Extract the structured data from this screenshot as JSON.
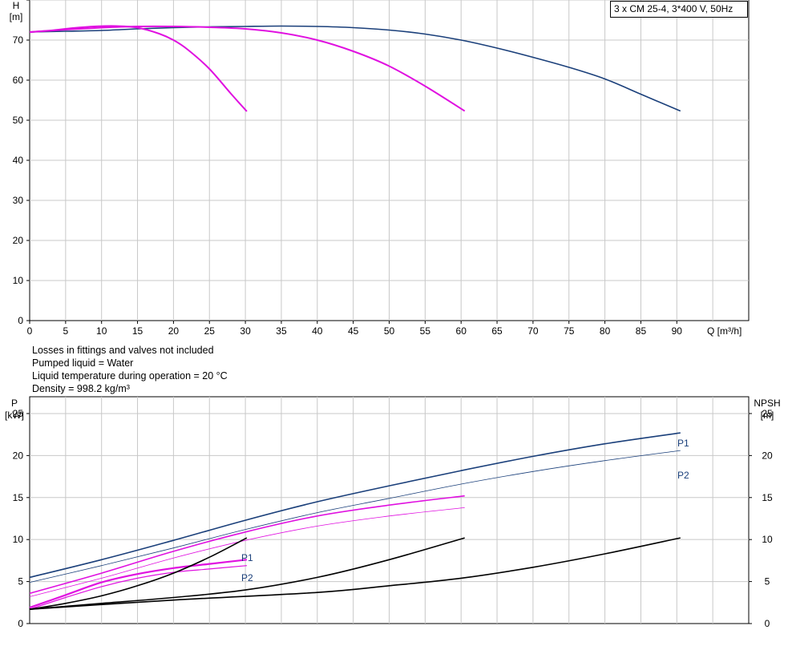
{
  "chart_data": [
    {
      "type": "line",
      "title": "3 x CM 25-4, 3*400 V, 50Hz",
      "ylabel": "H",
      "yunit": "[m]",
      "xlabel": "Q [m³/h]",
      "xlim": [
        0,
        100
      ],
      "ylim": [
        0,
        80
      ],
      "xticks": [
        "0",
        "5",
        "10",
        "15",
        "20",
        "25",
        "30",
        "35",
        "40",
        "45",
        "50",
        "55",
        "60",
        "65",
        "70",
        "75",
        "80",
        "85",
        "90"
      ],
      "yticks": [
        "0",
        "10",
        "20",
        "30",
        "40",
        "50",
        "60",
        "70"
      ],
      "grid": true,
      "series": [
        {
          "color": "#1a3f7a",
          "x": [
            0,
            5,
            10,
            15,
            20,
            25,
            30,
            35,
            40,
            45,
            50,
            55,
            60,
            65,
            70,
            75,
            80,
            85,
            90.5
          ],
          "y": [
            72,
            72.2,
            72.4,
            72.8,
            73.1,
            73.3,
            73.4,
            73.5,
            73.4,
            73.1,
            72.5,
            71.5,
            70,
            68,
            65.7,
            63.2,
            60.3,
            56.5,
            52.3
          ]
        },
        {
          "color": "#e010e0",
          "x": [
            0,
            5,
            10,
            15,
            20,
            25,
            30,
            35,
            40,
            45,
            50,
            55,
            60.5
          ],
          "y": [
            72,
            72.6,
            73.1,
            73.4,
            73.4,
            73.2,
            72.8,
            71.8,
            70,
            67.2,
            63.5,
            58.5,
            52.3
          ]
        },
        {
          "color": "#e010e0",
          "x": [
            0,
            3,
            6,
            9,
            12,
            15,
            18,
            20,
            22,
            25,
            28,
            30.2
          ],
          "y": [
            72,
            72.4,
            73.0,
            73.4,
            73.5,
            73.1,
            71.6,
            70.0,
            67.6,
            62.8,
            56.6,
            52.2
          ]
        }
      ]
    },
    {
      "type": "line",
      "ylabel": "P",
      "yunit": "[kW]",
      "y2label": "NPSH",
      "y2unit": "[m]",
      "xlim": [
        0,
        100
      ],
      "ylim": [
        0,
        27
      ],
      "yticks": [
        "0",
        "5",
        "10",
        "15",
        "20",
        "25"
      ],
      "y2ticks": [
        "0",
        "5",
        "10",
        "15",
        "20",
        "25"
      ],
      "grid": true,
      "series": [
        {
          "name": "P1",
          "color": "#1a3f7a",
          "width": 1.6,
          "x": [
            0,
            10,
            20,
            30,
            40,
            50,
            60,
            70,
            80,
            90.5
          ],
          "y": [
            5.5,
            7.6,
            9.9,
            12.3,
            14.5,
            16.4,
            18.2,
            19.9,
            21.4,
            22.7
          ]
        },
        {
          "name": "P2",
          "color": "#1a3f7a",
          "width": 0.8,
          "x": [
            0,
            10,
            20,
            30,
            40,
            50,
            60,
            70,
            80,
            90.5
          ],
          "y": [
            4.9,
            6.9,
            9.0,
            11.2,
            13.2,
            14.9,
            16.6,
            18.1,
            19.4,
            20.6
          ]
        },
        {
          "color": "#e010e0",
          "width": 1.6,
          "x": [
            0,
            10,
            20,
            30,
            40,
            50,
            60.5
          ],
          "y": [
            3.6,
            6.0,
            8.6,
            10.9,
            12.8,
            14.1,
            15.2
          ]
        },
        {
          "color": "#e010e0",
          "width": 0.8,
          "x": [
            0,
            10,
            20,
            30,
            40,
            50,
            60.5
          ],
          "y": [
            3.2,
            5.4,
            7.8,
            9.9,
            11.6,
            12.8,
            13.8
          ]
        },
        {
          "name": "P1",
          "color": "#e010e0",
          "width": 2.2,
          "x": [
            0,
            5,
            10,
            15,
            20,
            25,
            30.2
          ],
          "y": [
            1.9,
            3.4,
            4.9,
            5.9,
            6.6,
            7.1,
            7.6
          ]
        },
        {
          "name": "P2",
          "color": "#e010e0",
          "width": 1.2,
          "x": [
            0,
            5,
            10,
            15,
            20,
            25,
            30.2
          ],
          "y": [
            1.7,
            3.1,
            4.4,
            5.4,
            6.1,
            6.5,
            6.9
          ]
        },
        {
          "color": "#000000",
          "width": 1.6,
          "x": [
            0,
            5,
            10,
            15,
            20,
            25,
            30.2
          ],
          "y": [
            1.7,
            2.4,
            3.3,
            4.5,
            6.0,
            7.9,
            10.2
          ]
        },
        {
          "color": "#000000",
          "width": 1.6,
          "x": [
            0,
            10,
            20,
            30,
            40,
            50,
            60.5
          ],
          "y": [
            1.7,
            2.4,
            3.1,
            4.0,
            5.5,
            7.6,
            10.2
          ]
        },
        {
          "color": "#000000",
          "width": 1.6,
          "x": [
            0,
            20,
            40,
            50,
            60,
            70,
            80,
            90.5
          ],
          "y": [
            1.7,
            2.8,
            3.7,
            4.5,
            5.4,
            6.7,
            8.3,
            10.2
          ]
        }
      ]
    }
  ],
  "notes": [
    "Losses in fittings and valves not included",
    "Pumped liquid = Water",
    "Liquid temperature during operation = 20 °C",
    "Density = 998.2 kg/m³"
  ]
}
